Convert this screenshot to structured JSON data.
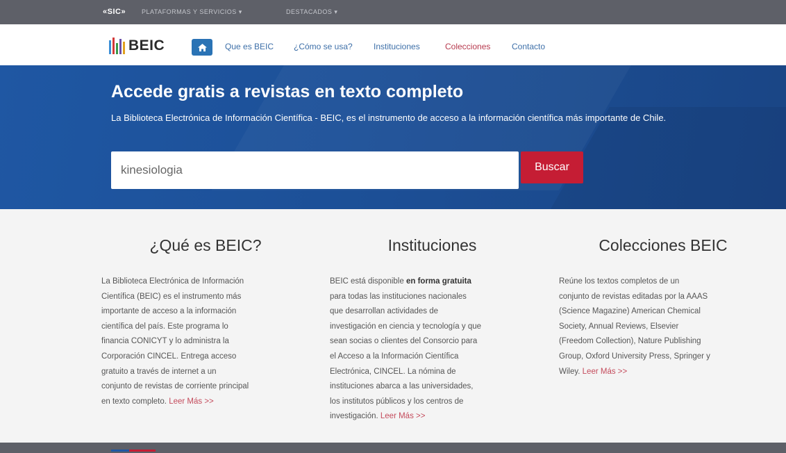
{
  "topbar": {
    "brand": "«SIC»",
    "menus": [
      "PLATAFORMAS Y SERVICIOS ▾",
      "DESTACADOS ▾"
    ]
  },
  "nav": {
    "logo_text": "BEIC",
    "home_icon": "home-icon",
    "links": [
      "Que es BEIC",
      "¿Cómo se usa?",
      "Instituciones",
      "Colecciones",
      "Contacto"
    ],
    "active_link": "Colecciones",
    "colors": {
      "home_button": "#2a73b5",
      "link": "#3d6fa8",
      "active": "#b73a4e"
    }
  },
  "hero": {
    "title": "Accede gratis a revistas en texto completo",
    "subtitle": "La Biblioteca Electrónica de Información Científica - BEIC, es el instrumento de acceso a la información científica más importante de Chile.",
    "search_value": "kinesiologia",
    "search_button": "Buscar",
    "colors": {
      "background": "#1f57a3",
      "button": "#c51d34"
    }
  },
  "columns": [
    {
      "title": "¿Qué es BEIC?",
      "lines": [
        "La Biblioteca Electrónica de Información",
        "Científica (BEIC) es el instrumento más",
        "importante de acceso a la información",
        "científica del país. Este programa lo",
        "financia CONICYT y lo administra la",
        "Corporación CINCEL. Entrega acceso",
        "gratuito a través de internet a un",
        "conjunto de revistas de corriente principal"
      ],
      "last_line": "en texto completo.",
      "more": "Leer Más >>"
    },
    {
      "title": "Instituciones",
      "first_line_pre": "BEIC está disponible",
      "first_line_bold": "en forma gratuita",
      "lines": [
        "para todas las instituciones nacionales",
        "que desarrollan actividades de",
        "investigación en ciencia y tecnología y que",
        "sean socias o clientes del Consorcio para",
        "el Acceso a la Información Científica",
        "Electrónica, CINCEL. La nómina de",
        "instituciones abarca a las universidades,",
        "los institutos públicos y los centros de"
      ],
      "last_line": "investigación.",
      "more": "Leer Más >>"
    },
    {
      "title": "Colecciones BEIC",
      "lines": [
        "Reúne los textos completos de un",
        "conjunto de revistas editadas por la AAAS",
        "(Science Magazine) American Chemical",
        "Society, Annual Reviews, Elsevier",
        "(Freedom Collection), Nature Publishing",
        "Group, Oxford University Press, Springer y"
      ],
      "last_line": "Wiley.",
      "more": "Leer Más >>"
    }
  ]
}
